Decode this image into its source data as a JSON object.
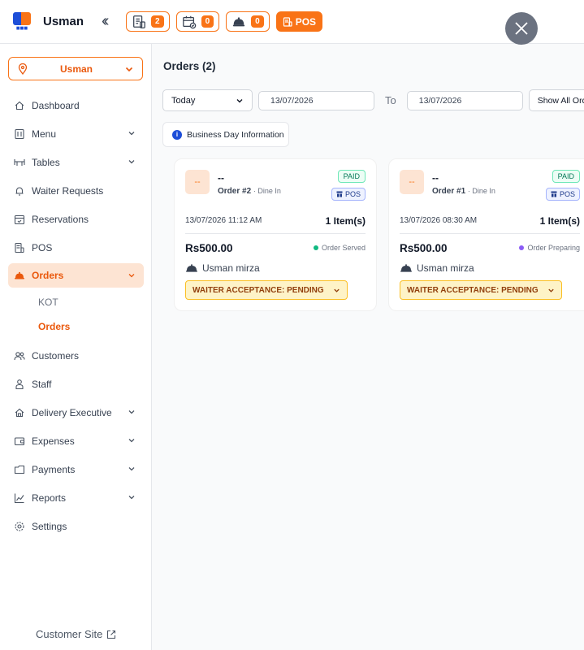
{
  "header": {
    "brand": "Usman",
    "collapse_icon": "double-chevron-left",
    "badges": [
      {
        "icon": "orders-receipt-icon",
        "count": "2"
      },
      {
        "icon": "reservation-calendar-icon",
        "count": "0"
      },
      {
        "icon": "waiter-cloche-icon",
        "count": "0"
      }
    ],
    "pos_label": "POS",
    "accent": "#f97316"
  },
  "sidebar": {
    "branch": "Usman",
    "items": [
      {
        "label": "Dashboard",
        "icon": "home-icon"
      },
      {
        "label": "Menu",
        "icon": "menu-icon",
        "has_submenu": true
      },
      {
        "label": "Tables",
        "icon": "tables-icon",
        "has_submenu": true
      },
      {
        "label": "Waiter Requests",
        "icon": "bell-icon"
      },
      {
        "label": "Reservations",
        "icon": "calendar-icon"
      },
      {
        "label": "POS",
        "icon": "pos-icon"
      },
      {
        "label": "Orders",
        "icon": "cloche-icon",
        "has_submenu": true,
        "active": true
      },
      {
        "label": "Customers",
        "icon": "users-icon"
      },
      {
        "label": "Staff",
        "icon": "staff-icon"
      },
      {
        "label": "Delivery Executive",
        "icon": "delivery-icon",
        "has_submenu": true
      },
      {
        "label": "Expenses",
        "icon": "wallet-icon",
        "has_submenu": true
      },
      {
        "label": "Payments",
        "icon": "payments-icon",
        "has_submenu": true
      },
      {
        "label": "Reports",
        "icon": "chart-icon",
        "has_submenu": true
      },
      {
        "label": "Settings",
        "icon": "gear-icon"
      }
    ],
    "orders_sub": [
      {
        "label": "KOT"
      },
      {
        "label": "Orders",
        "active": true
      }
    ],
    "customer_site": "Customer Site"
  },
  "main": {
    "title": "Orders (2)",
    "filters": {
      "period": "Today",
      "from": "13/07/2026",
      "to_label": "To",
      "to": "13/07/2026",
      "show_all": "Show All Orders"
    },
    "business_day_info": "Business Day Information",
    "orders": [
      {
        "customer": "--",
        "avatar": "--",
        "order_no": "Order #2",
        "type": "· Dine In",
        "paid": "PAID",
        "source": "POS",
        "datetime": "13/07/2026 11:12 AM",
        "items": "1 Item(s)",
        "amount": "Rs500.00",
        "status": "Order Served",
        "status_color": "#10b981",
        "waiter": "Usman mirza",
        "acceptance": "WAITER ACCEPTANCE: PENDING"
      },
      {
        "customer": "--",
        "avatar": "--",
        "order_no": "Order #1",
        "type": "· Dine In",
        "paid": "PAID",
        "source": "POS",
        "datetime": "13/07/2026 08:30 AM",
        "items": "1 Item(s)",
        "amount": "Rs500.00",
        "status": "Order Preparing",
        "status_color": "#8b5cf6",
        "waiter": "Usman mirza",
        "acceptance": "WAITER ACCEPTANCE: PENDING"
      }
    ]
  }
}
